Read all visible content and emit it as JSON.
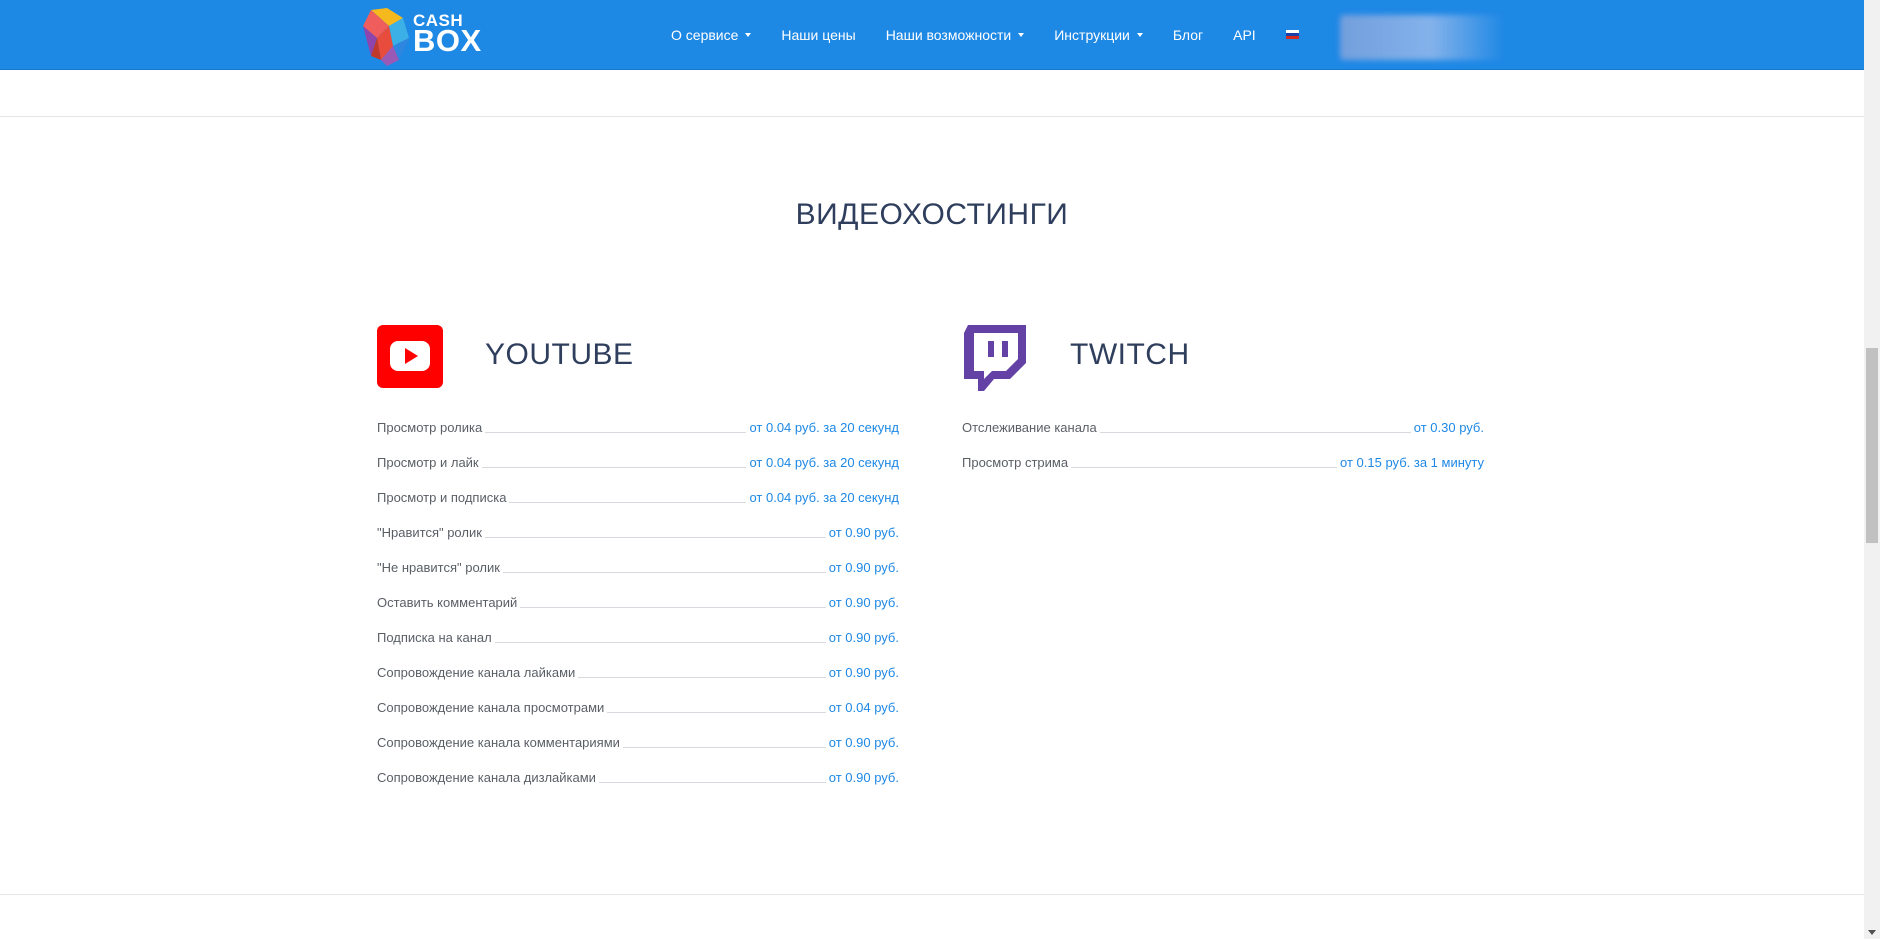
{
  "header": {
    "logo": {
      "line1": "CASH",
      "line2": "BOX"
    },
    "nav": [
      {
        "label": "О сервисе",
        "dropdown": true
      },
      {
        "label": "Наши цены",
        "dropdown": false
      },
      {
        "label": "Наши возможности",
        "dropdown": true
      },
      {
        "label": "Инструкции",
        "dropdown": true
      },
      {
        "label": "Блог",
        "dropdown": false
      },
      {
        "label": "API",
        "dropdown": false
      }
    ],
    "language_icon": "flag-ru-icon"
  },
  "section": {
    "title": "ВИДЕОХОСТИНГИ"
  },
  "youtube": {
    "name": "YOUTUBE",
    "icon": "youtube-icon",
    "color": "#ff0000",
    "items": [
      {
        "name": "Просмотр ролика",
        "price": "от 0.04 руб. за 20 секунд"
      },
      {
        "name": "Просмотр и лайк",
        "price": "от 0.04 руб. за 20 секунд"
      },
      {
        "name": "Просмотр и подписка",
        "price": "от 0.04 руб. за 20 секунд"
      },
      {
        "name": "\"Нравится\" ролик",
        "price": "от 0.90 руб."
      },
      {
        "name": "\"Не нравится\" ролик",
        "price": "от 0.90 руб."
      },
      {
        "name": "Оставить комментарий",
        "price": "от 0.90 руб."
      },
      {
        "name": "Подписка на канал",
        "price": "от 0.90 руб."
      },
      {
        "name": "Сопровождение канала лайками",
        "price": "от 0.90 руб."
      },
      {
        "name": "Сопровождение канала просмотрами",
        "price": "от 0.04 руб."
      },
      {
        "name": "Сопровождение канала комментариями",
        "price": "от 0.90 руб."
      },
      {
        "name": "Сопровождение канала дизлайками",
        "price": "от 0.90 руб."
      }
    ]
  },
  "twitch": {
    "name": "TWITCH",
    "icon": "twitch-icon",
    "color": "#6441a4",
    "items": [
      {
        "name": "Отслеживание канала",
        "price": "от 0.30 руб."
      },
      {
        "name": "Просмотр стрима",
        "price": "от 0.15 руб. за 1 минуту"
      }
    ]
  },
  "colors": {
    "header_bg": "#1e88e5",
    "price_text": "#1e88e5",
    "title_text": "#2e3e5c"
  }
}
